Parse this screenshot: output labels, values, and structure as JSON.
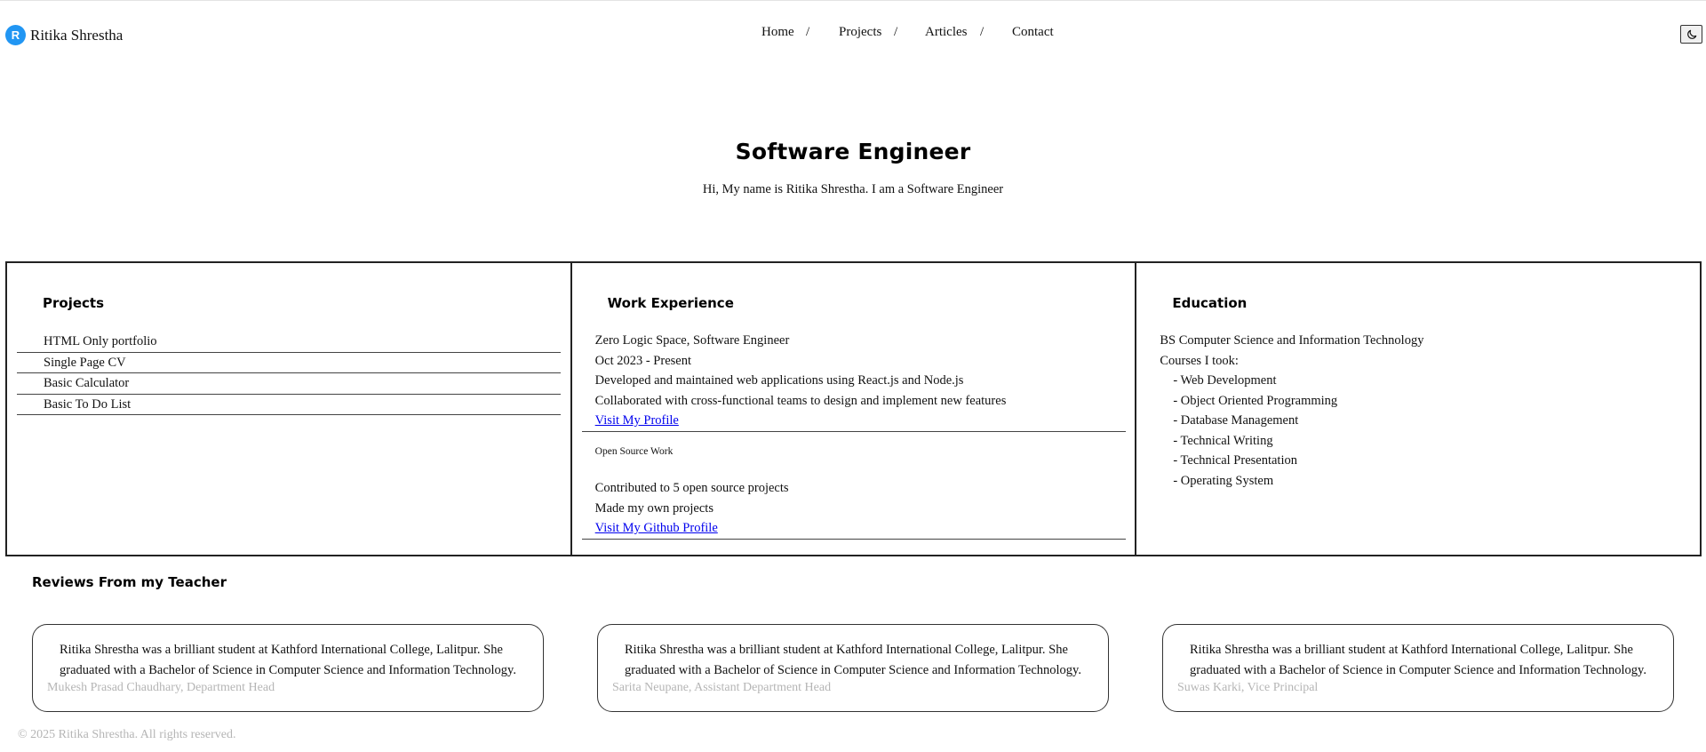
{
  "header": {
    "logo_letter": "R",
    "brand_name": "Ritika Shrestha",
    "nav": [
      {
        "label": "Home"
      },
      {
        "label": "Projects"
      },
      {
        "label": "Articles"
      },
      {
        "label": "Contact"
      }
    ],
    "separator": "/",
    "theme_toggle_icon": "moon-icon"
  },
  "hero": {
    "title": "Software Engineer",
    "subtitle": "Hi, My name is Ritika Shrestha. I am a Software Engineer"
  },
  "projects": {
    "title": "Projects",
    "items": [
      "HTML Only portfolio",
      "Single Page CV",
      "Basic Calculator",
      "Basic To Do List"
    ]
  },
  "work": {
    "title": "Work Experience",
    "lines": [
      "Zero Logic Space, Software Engineer",
      "Oct 2023 - Present",
      "Developed and maintained web applications using React.js and Node.js",
      "Collaborated with cross-functional teams to design and implement new features"
    ],
    "profile_link": "Visit My Profile",
    "open_source_heading": "Open Source Work",
    "open_source_lines": [
      "Contributed to 5 open source projects",
      "Made my own projects"
    ],
    "github_link": "Visit My Github Profile"
  },
  "education": {
    "title": "Education",
    "degree": "BS Computer Science and Information Technology",
    "courses_label": "Courses I took:",
    "courses": [
      "- Web Development",
      "- Object Oriented Programming",
      "- Database Management",
      "- Technical Writing",
      "- Technical Presentation",
      "- Operating System"
    ]
  },
  "reviews": {
    "title": "Reviews From my Teacher",
    "items": [
      {
        "quote": "Ritika Shrestha was a brilliant student at Kathford International College, Lalitpur. She graduated with a Bachelor of Science in Computer Science and Information Technology.",
        "author": "Mukesh Prasad Chaudhary, Department Head"
      },
      {
        "quote": "Ritika Shrestha was a brilliant student at Kathford International College, Lalitpur. She graduated with a Bachelor of Science in Computer Science and Information Technology.",
        "author": "Sarita Neupane, Assistant Department Head"
      },
      {
        "quote": "Ritika Shrestha was a brilliant student at Kathford International College, Lalitpur. She graduated with a Bachelor of Science in Computer Science and Information Technology.",
        "author": "Suwas Karki, Vice Principal"
      }
    ]
  },
  "footer": {
    "text": "© 2025 Ritika Shrestha. All rights reserved."
  },
  "colors": {
    "logo_bg": "#2196f3",
    "link": "#0000ee",
    "muted_text": "#b5b5b5",
    "border": "#222222"
  }
}
